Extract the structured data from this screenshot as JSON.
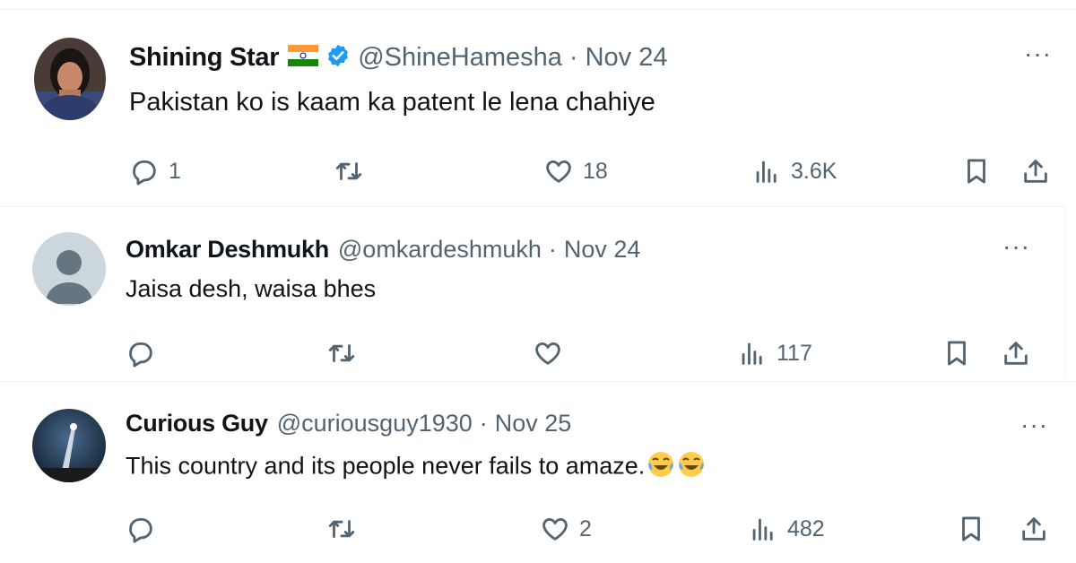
{
  "tweets": [
    {
      "name": "Shining Star",
      "has_flag": true,
      "flag_icon": "india-flag-icon",
      "verified": true,
      "handle": "@ShineHamesha",
      "separator": "·",
      "date": "Nov 24",
      "text": "Pakistan ko is kaam ka patent le lena chahiye",
      "replies": "1",
      "retweets": "",
      "likes": "18",
      "views": "3.6K",
      "more": "···"
    },
    {
      "name": "Omkar Deshmukh",
      "handle": "@omkardeshmukh",
      "separator": "·",
      "date": "Nov 24",
      "text": "Jaisa desh, waisa bhes",
      "replies": "",
      "retweets": "",
      "likes": "",
      "views": "117",
      "more": "···"
    },
    {
      "name": "Curious Guy",
      "handle": "@curiousguy1930",
      "separator": "·",
      "date": "Nov 25",
      "text": "This country and its people never fails to amaze.",
      "emoji": [
        "face-with-tears-of-joy-icon",
        "face-with-tears-of-joy-icon"
      ],
      "replies": "",
      "retweets": "",
      "likes": "2",
      "views": "482",
      "more": "···"
    }
  ],
  "colors": {
    "text": "#0f1419",
    "muted": "#536471",
    "verified": "#1d9bf0",
    "divider": "#eff3f4"
  }
}
